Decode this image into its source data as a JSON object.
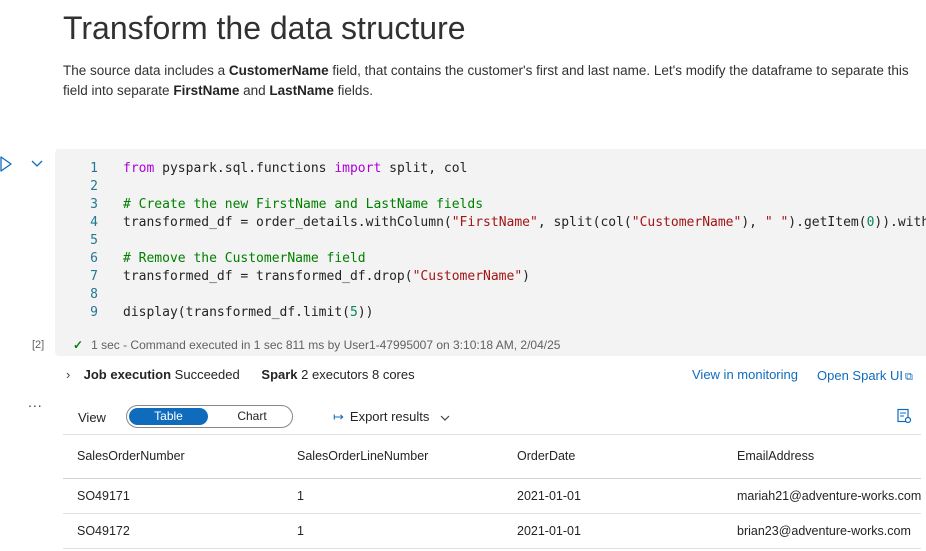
{
  "heading": "Transform the data structure",
  "description": {
    "p1": "The source data includes a ",
    "b1": "CustomerName",
    "p2": " field, that contains the customer's first and last name. Let's modify the dataframe to separate this field into separate ",
    "b2": "FirstName",
    "p3": " and ",
    "b3": "LastName",
    "p4": " fields."
  },
  "code": {
    "line_numbers": [
      "1",
      "2",
      "3",
      "4",
      "5",
      "6",
      "7",
      "8",
      "9"
    ]
  },
  "execution": {
    "count": "[2]",
    "status": "1 sec - Command executed in 1 sec 811 ms by User1-47995007 on 3:10:18 AM, 2/04/25"
  },
  "job": {
    "label": "Job execution",
    "status": "Succeeded",
    "spark_label": "Spark",
    "spark_detail": "2 executors 8 cores",
    "monitor_link": "View in monitoring",
    "spark_ui_link": "Open Spark UI"
  },
  "results": {
    "ellipsis": "...",
    "view_label": "View",
    "toggle_table": "Table",
    "toggle_chart": "Chart",
    "export_label": "Export results",
    "columns": [
      "SalesOrderNumber",
      "SalesOrderLineNumber",
      "OrderDate",
      "EmailAddress"
    ],
    "rows": [
      [
        "SO49171",
        "1",
        "2021-01-01",
        "mariah21@adventure-works.com"
      ],
      [
        "SO49172",
        "1",
        "2021-01-01",
        "brian23@adventure-works.com"
      ]
    ]
  },
  "colors": {
    "accent": "#0f6cbd",
    "success": "#107c10",
    "code_bg": "#f3f3f3"
  }
}
